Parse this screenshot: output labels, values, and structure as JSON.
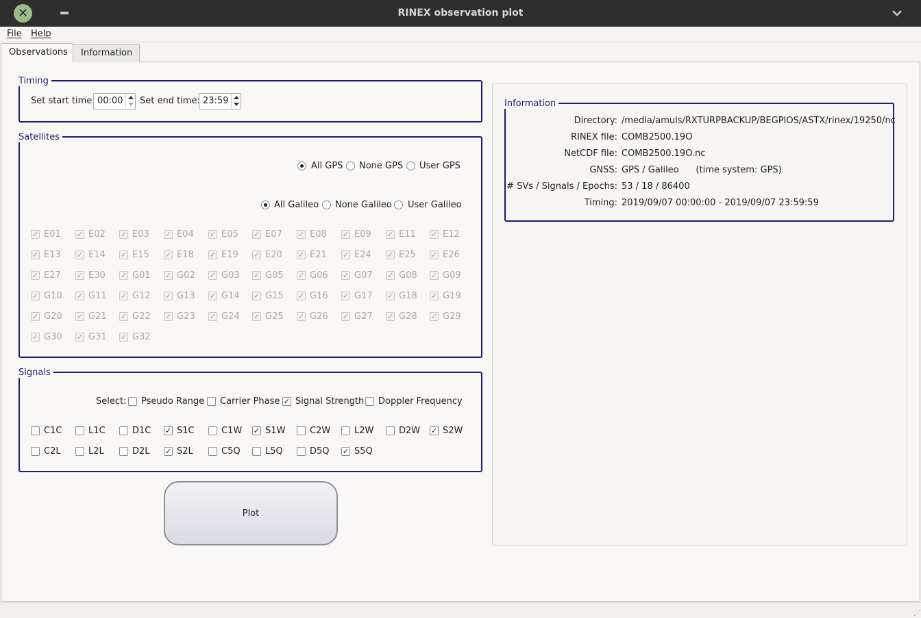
{
  "window": {
    "title": "RINEX observation plot"
  },
  "menu": {
    "file": "File",
    "help": "Help"
  },
  "tabs": [
    {
      "label": "Observations"
    },
    {
      "label": "Information"
    }
  ],
  "timing": {
    "title": "Timing",
    "start_label": "Set start time:",
    "start_value": "00:00",
    "end_label": "Set end time:",
    "end_value": "23:59"
  },
  "satellites": {
    "title": "Satellites",
    "gps_options": [
      {
        "label": "All GPS",
        "checked": true
      },
      {
        "label": "None GPS",
        "checked": false
      },
      {
        "label": "User GPS",
        "checked": false
      }
    ],
    "galileo_options": [
      {
        "label": "All Galileo",
        "checked": true
      },
      {
        "label": "None Galileo",
        "checked": false
      },
      {
        "label": "User Galileo",
        "checked": false
      }
    ],
    "list": [
      "E01",
      "E02",
      "E03",
      "E04",
      "E05",
      "E07",
      "E08",
      "E09",
      "E11",
      "E12",
      "E13",
      "E14",
      "E15",
      "E18",
      "E19",
      "E20",
      "E21",
      "E24",
      "E25",
      "E26",
      "E27",
      "E30",
      "G01",
      "G02",
      "G03",
      "G05",
      "G06",
      "G07",
      "G08",
      "G09",
      "G10",
      "G11",
      "G12",
      "G13",
      "G14",
      "G15",
      "G16",
      "G17",
      "G18",
      "G19",
      "G20",
      "G21",
      "G22",
      "G23",
      "G24",
      "G25",
      "G26",
      "G27",
      "G28",
      "G29",
      "G30",
      "G31",
      "G32"
    ]
  },
  "signals": {
    "title": "Signals",
    "select_label": "Select:",
    "types": [
      {
        "label": "Pseudo Range",
        "checked": false
      },
      {
        "label": "Carrier Phase",
        "checked": false
      },
      {
        "label": "Signal Strength",
        "checked": true
      },
      {
        "label": "Doppler Frequency",
        "checked": false
      }
    ],
    "rows": [
      [
        {
          "label": "C1C",
          "checked": false
        },
        {
          "label": "L1C",
          "checked": false
        },
        {
          "label": "D1C",
          "checked": false
        },
        {
          "label": "S1C",
          "checked": true
        },
        {
          "label": "C1W",
          "checked": false
        },
        {
          "label": "S1W",
          "checked": true
        },
        {
          "label": "C2W",
          "checked": false
        },
        {
          "label": "L2W",
          "checked": false
        },
        {
          "label": "D2W",
          "checked": false
        },
        {
          "label": "S2W",
          "checked": true
        }
      ],
      [
        {
          "label": "C2L",
          "checked": false
        },
        {
          "label": "L2L",
          "checked": false
        },
        {
          "label": "D2L",
          "checked": false
        },
        {
          "label": "S2L",
          "checked": true
        },
        {
          "label": "C5Q",
          "checked": false
        },
        {
          "label": "L5Q",
          "checked": false
        },
        {
          "label": "D5Q",
          "checked": false
        },
        {
          "label": "S5Q",
          "checked": true
        }
      ]
    ]
  },
  "plot_button": "Plot",
  "information": {
    "title": "Information",
    "rows": [
      {
        "key": "Directory:",
        "value": "/media/amuls/RXTURPBACKUP/BEGPIOS/ASTX/rinex/19250/nc"
      },
      {
        "key": "RINEX file:",
        "value": "COMB2500.19O"
      },
      {
        "key": "NetCDF file:",
        "value": "COMB2500.19O.nc"
      },
      {
        "key": "GNSS:",
        "value": "GPS / Galileo      (time system: GPS)"
      },
      {
        "key": "# SVs / Signals / Epochs:",
        "value": "53 / 18 / 86400"
      },
      {
        "key": "Timing:",
        "value": "2019/09/07 00:00:00 - 2019/09/07 23:59:59"
      }
    ]
  },
  "icons": {
    "close": "close-icon",
    "minimize": "minimize-icon",
    "menu": "chevron-down-icon",
    "grip": "size-grip-icon"
  },
  "colors": {
    "group_border": "#1c1c6b",
    "titlebar": "#2e2e2e",
    "close_button": "#9dbb86"
  }
}
